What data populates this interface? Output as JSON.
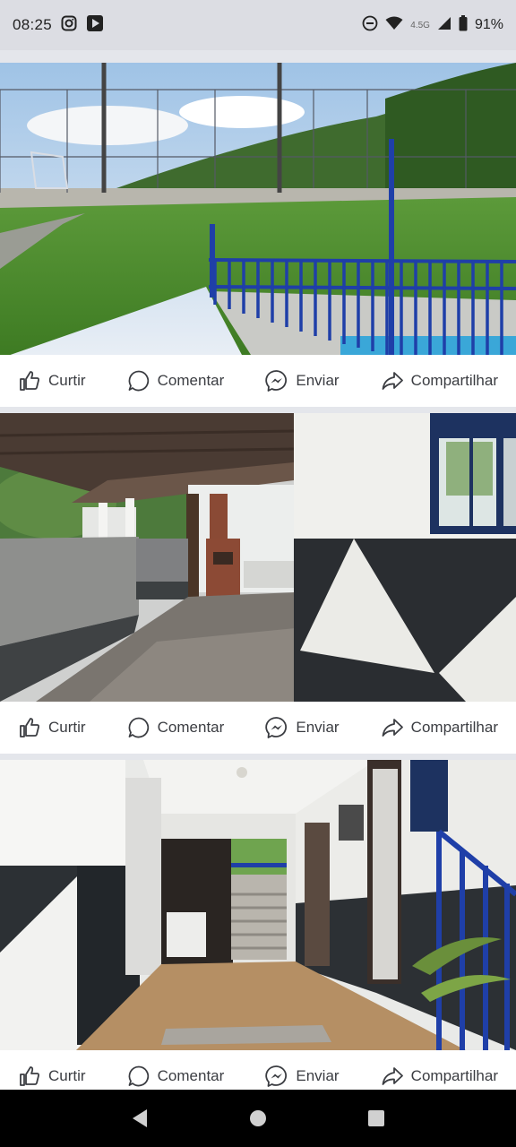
{
  "status_bar": {
    "time": "08:25",
    "network_label": "4.5G",
    "battery": "91%",
    "icons": [
      "instagram-icon",
      "play-store-icon",
      "do-not-disturb-icon",
      "wifi-icon",
      "signal-icon",
      "battery-icon"
    ]
  },
  "posts": [
    {
      "photo_description_icon": "photo",
      "actions": {
        "like": "Curtir",
        "comment": "Comentar",
        "send": "Enviar",
        "share": "Compartilhar"
      }
    },
    {
      "photo_description_icon": "photo",
      "actions": {
        "like": "Curtir",
        "comment": "Comentar",
        "send": "Enviar",
        "share": "Compartilhar"
      }
    },
    {
      "photo_description_icon": "photo",
      "actions": {
        "like": "Curtir",
        "comment": "Comentar",
        "send": "Enviar",
        "share": "Compartilhar"
      }
    }
  ],
  "nav": {
    "icons": [
      "back-icon",
      "home-icon",
      "recents-icon"
    ]
  },
  "colors": {
    "fence_blue": "#1f3fa8",
    "action_text": "#3b3d42",
    "divider": "#e4e6eb",
    "status_bg": "#dcdde3"
  }
}
